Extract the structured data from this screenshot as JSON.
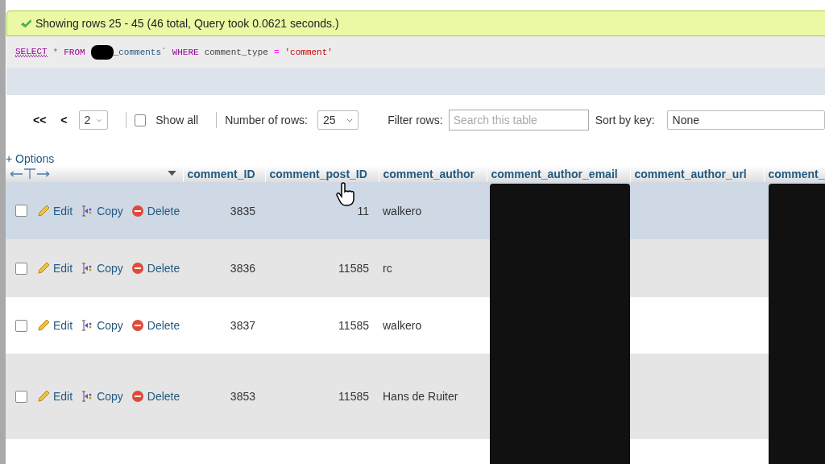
{
  "message": {
    "text": "Showing rows 25 - 45 (46 total, Query took 0.0621 seconds.)"
  },
  "sql": [
    {
      "kind": "keyword",
      "text": "SELECT"
    },
    {
      "kind": "operator",
      "text": "*"
    },
    {
      "kind": "keyword",
      "text": "FROM"
    },
    {
      "kind": "redacted"
    },
    {
      "kind": "identifier",
      "text": "_comments`"
    },
    {
      "kind": "keyword",
      "text": "WHERE"
    },
    {
      "kind": "plain",
      "text": "comment_type"
    },
    {
      "kind": "operator",
      "text": "="
    },
    {
      "kind": "string",
      "text": "'comment'"
    }
  ],
  "navigation": {
    "first": "<<",
    "previous": "<",
    "page": "2",
    "show_all": {
      "label": "Show all",
      "checked": false
    },
    "rows_label": "Number of rows:",
    "rows": "25",
    "filter_label": "Filter rows:",
    "filter_placeholder": "Search this table",
    "sort_label": "Sort by key:",
    "sort": "None"
  },
  "options": "+ Options",
  "columns": [
    "comment_ID",
    "comment_post_ID",
    "comment_author",
    "comment_author_email",
    "comment_author_url",
    "comment_"
  ],
  "rows": [
    {
      "checked": false,
      "hovered": true,
      "actions": {
        "edit": "Edit",
        "copy": "Copy",
        "delete": "Delete"
      },
      "cells": [
        "3835",
        "11",
        "walkero"
      ]
    },
    {
      "checked": false,
      "hovered": false,
      "actions": {
        "edit": "Edit",
        "copy": "Copy",
        "delete": "Delete"
      },
      "cells": [
        "3836",
        "11585",
        "rc"
      ]
    },
    {
      "checked": false,
      "hovered": false,
      "actions": {
        "edit": "Edit",
        "copy": "Copy",
        "delete": "Delete"
      },
      "cells": [
        "3837",
        "11585",
        "walkero"
      ]
    },
    {
      "checked": false,
      "hovered": false,
      "actions": {
        "edit": "Edit",
        "copy": "Copy",
        "delete": "Delete"
      },
      "cells": [
        "3853",
        "11585",
        "Hans de Ruiter"
      ]
    }
  ]
}
